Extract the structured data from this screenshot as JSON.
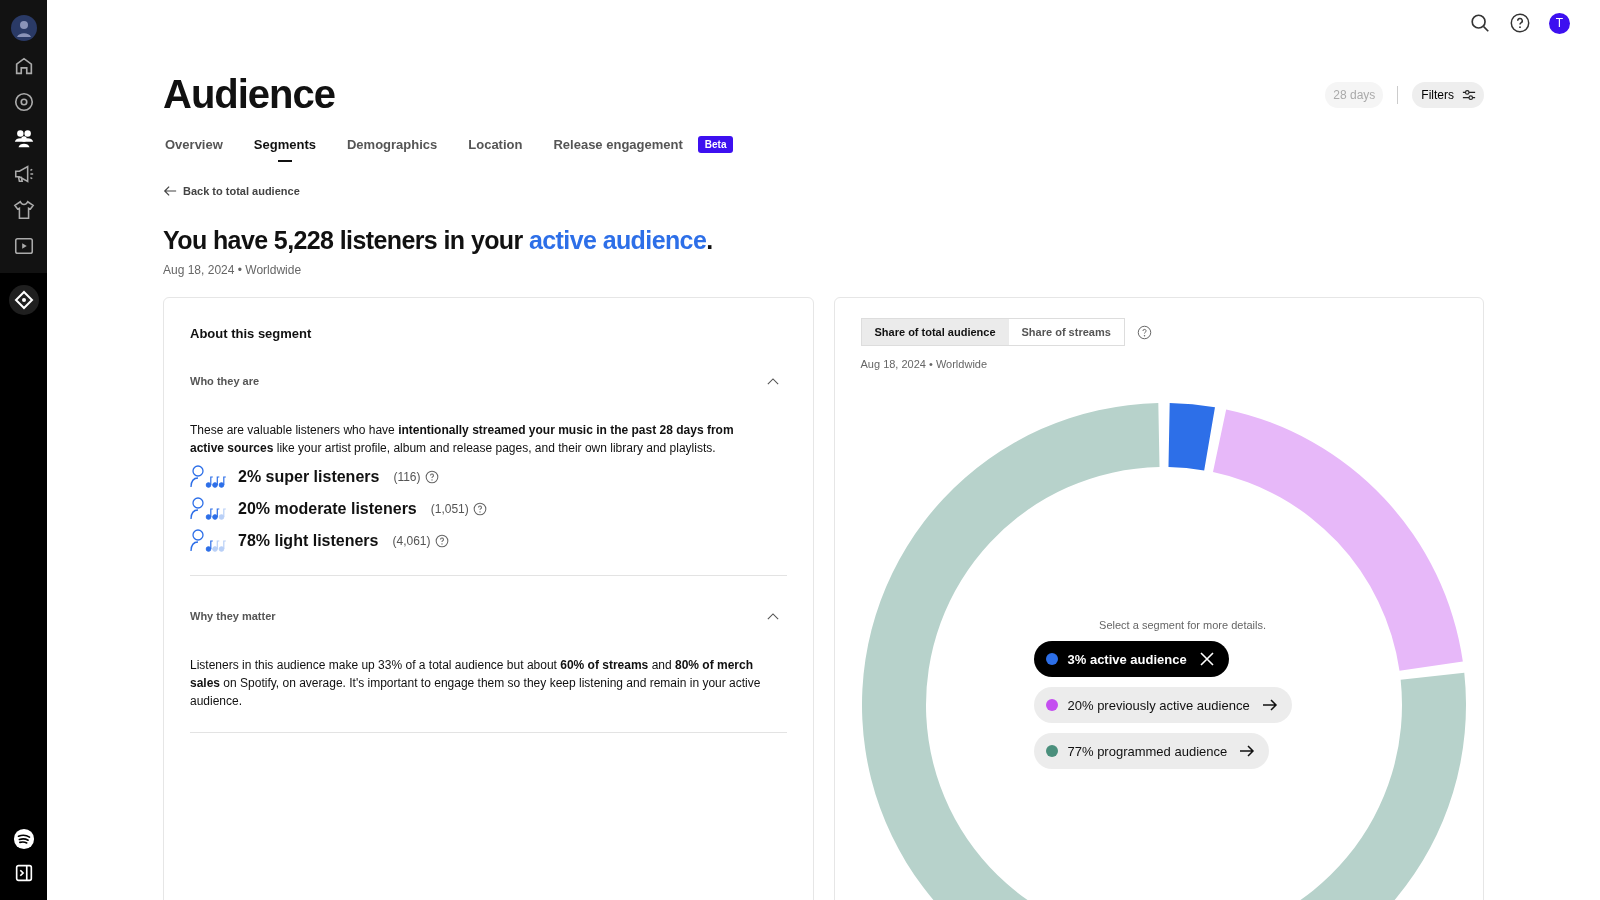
{
  "title": "Audience",
  "tabs": [
    {
      "label": "Overview",
      "selected": false
    },
    {
      "label": "Segments",
      "selected": true
    },
    {
      "label": "Demographics",
      "selected": false
    },
    {
      "label": "Location",
      "selected": false
    },
    {
      "label": "Release engagement",
      "selected": false,
      "badge": "Beta"
    }
  ],
  "period": "28 days",
  "filters_button": "Filters",
  "avatar_initial": "T",
  "back_link": "Back to total audience",
  "headline": {
    "text": "You have 5,228 listeners in your ",
    "link": "active audience",
    "end": "."
  },
  "subtitle": "Aug 18, 2024 • Worldwide",
  "about": {
    "title": "About this segment",
    "sections": [
      {
        "heading": "Who they are",
        "expanded": true,
        "text": "These are valuable listeners who have **intentionally streamed your music in the past 28 days from active sources** like your artist profile, album and release pages, and their own library and playlists.",
        "listeners": [
          {
            "kind": "super",
            "label": "2% super listeners",
            "count": "(116)"
          },
          {
            "kind": "moderate",
            "label": "20% moderate listeners",
            "count": "(1,051)"
          },
          {
            "kind": "light",
            "label": "78% light listeners",
            "count": "(4,061)"
          }
        ]
      },
      {
        "heading": "Why they matter",
        "expanded": true,
        "text": "Listeners in this audience make up 33% of a total audience but about **60% of streams** and **80% of merch sales** on Spotify, on average. It's important to engage them so they keep listening and remain in your active audience."
      }
    ]
  },
  "share": {
    "toggle": [
      {
        "label": "Share of total audience",
        "selected": true
      },
      {
        "label": "Share of streams",
        "selected": false
      }
    ],
    "subtitle": "Aug 18, 2024 • Worldwide",
    "hint": "Select a segment for more details.",
    "segments": [
      {
        "label": "3% active audience",
        "color": "#2d6fe8",
        "selected": true
      },
      {
        "label": "20% previously active audience",
        "color": "#c44ef0",
        "selected": false
      },
      {
        "label": "77% programmed audience",
        "color": "#4a8f7c",
        "selected": false
      }
    ],
    "chart_data": {
      "type": "donut",
      "values": [
        3,
        20,
        77
      ]
    }
  }
}
